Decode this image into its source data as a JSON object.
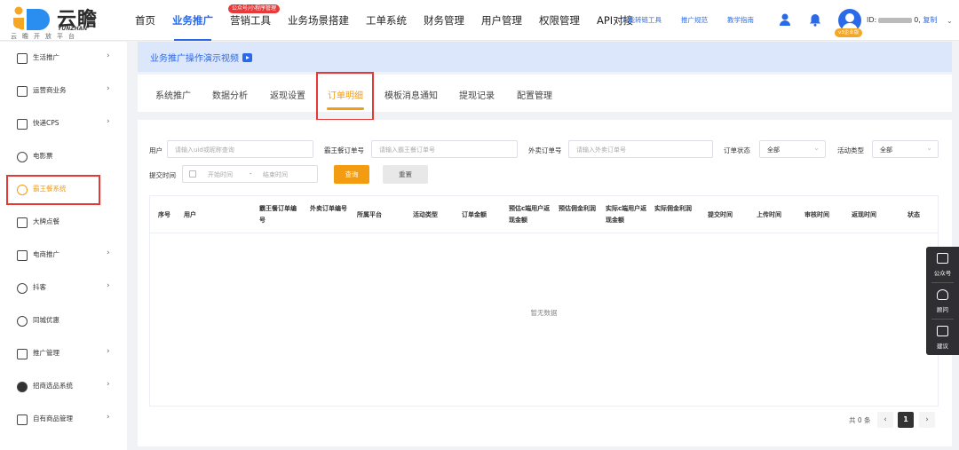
{
  "header": {
    "logo": {
      "name": "云瞻",
      "en": "YUNZHAN",
      "sub": "云瞻开放平台"
    },
    "nav": [
      {
        "label": "首页"
      },
      {
        "label": "业务推广",
        "active": true
      },
      {
        "label": "营销工具",
        "badge": "公众号/小程序管理"
      },
      {
        "label": "业务场景搭建"
      },
      {
        "label": "工单系统"
      },
      {
        "label": "财务管理"
      },
      {
        "label": "用户管理"
      },
      {
        "label": "权限管理"
      },
      {
        "label": "API对接"
      }
    ],
    "links": [
      "万能转链工具",
      "推广规范",
      "教学指南"
    ],
    "icons": [
      "user-service-icon",
      "bell-icon"
    ],
    "user": {
      "id_prefix": "ID:",
      "id_suffix": "0,",
      "copy": "复制",
      "vip": "v3企业版"
    }
  },
  "sidebar": {
    "items": [
      {
        "label": "生活推广",
        "icon": "life-icon",
        "chevron": true
      },
      {
        "label": "运营商业务",
        "icon": "operator-icon",
        "chevron": true
      },
      {
        "label": "快递CPS",
        "icon": "express-icon",
        "chevron": true
      },
      {
        "label": "电影票",
        "icon": "movie-icon",
        "chevron": false
      },
      {
        "label": "霸王餐系统",
        "icon": "meal-icon",
        "chevron": false,
        "active": true
      },
      {
        "label": "大牌点餐",
        "icon": "order-food-icon",
        "chevron": false
      },
      {
        "label": "电商推广",
        "icon": "ecommerce-icon",
        "chevron": true
      },
      {
        "label": "抖客",
        "icon": "douke-icon",
        "chevron": true
      },
      {
        "label": "同城优惠",
        "icon": "location-icon",
        "chevron": false
      },
      {
        "label": "推广管理",
        "icon": "manage-icon",
        "chevron": true
      },
      {
        "label": "招商选品系统",
        "icon": "select-icon",
        "chevron": true
      },
      {
        "label": "自有商品管理",
        "icon": "goods-icon",
        "chevron": true
      }
    ]
  },
  "banner": {
    "text": "业务推广操作演示视频"
  },
  "tabs": [
    {
      "label": "系统推广"
    },
    {
      "label": "数据分析"
    },
    {
      "label": "返现设置"
    },
    {
      "label": "订单明细",
      "active": true
    },
    {
      "label": "模板消息通知"
    },
    {
      "label": "提现记录"
    },
    {
      "label": "配置管理"
    }
  ],
  "filters": {
    "user": {
      "label": "用户",
      "placeholder": "请输入uid或昵称查询"
    },
    "bwc_order": {
      "label": "霸王餐订单号",
      "placeholder": "请输入霸王餐订单号"
    },
    "takeout_order": {
      "label": "外卖订单号",
      "placeholder": "请输入外卖订单号"
    },
    "order_status": {
      "label": "订单状态",
      "value": "全部"
    },
    "activity_type": {
      "label": "活动类型",
      "value": "全部"
    },
    "submit_time": {
      "label": "提交时间",
      "start": "开始时间",
      "sep": "-",
      "end": "结束时间"
    },
    "query": "查询",
    "reset": "重置"
  },
  "table": {
    "columns": [
      "序号",
      "用户",
      "霸王餐订单编号",
      "外卖订单编号",
      "所属平台",
      "活动类型",
      "订单金额",
      "预估c端用户返现金额",
      "预估佣金利润",
      "实际c端用户返现金额",
      "实际佣金利润",
      "提交时间",
      "上传时间",
      "审核时间",
      "返现时间",
      "状态"
    ],
    "empty": "暂无数据"
  },
  "pagination": {
    "total": "共 0 条",
    "page": "1",
    "prev": "‹",
    "next": "›"
  },
  "float_panel": [
    {
      "label": "公众号",
      "icon": "wechat-icon"
    },
    {
      "label": "顾问",
      "icon": "headset-icon"
    },
    {
      "label": "建议",
      "icon": "edit-icon"
    }
  ],
  "colors": {
    "primary": "#2a6ae9",
    "accent": "#f39c12",
    "highlight": "#e53935"
  }
}
